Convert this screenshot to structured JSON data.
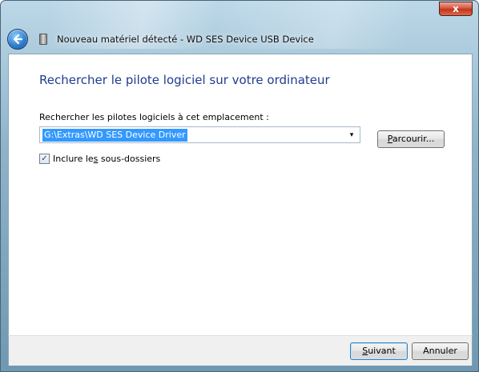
{
  "window": {
    "title": "Nouveau matériel détecté - WD SES Device USB Device",
    "close_symbol": "x"
  },
  "icons": {
    "back": "back-arrow-icon",
    "device": "usb-device-icon",
    "dropdown": "chevron-down-icon",
    "check": "checkmark-icon"
  },
  "colors": {
    "heading": "#1e3d8f",
    "selection": "#3399ff",
    "close_button": "#c0351c"
  },
  "main": {
    "heading": "Rechercher le pilote logiciel sur votre ordinateur",
    "location_label": "Rechercher les pilotes logiciels à cet emplacement :",
    "location_value": "G:\\Extras\\WD SES Device Driver",
    "dropdown_arrow": "▾",
    "browse_label_accel": "P",
    "browse_label_rest": "arcourir...",
    "include_subfolders_pre": "Inclure le",
    "include_subfolders_accel": "s",
    "include_subfolders_post": " sous-dossiers",
    "include_subfolders_checked": true,
    "check_mark": "✓"
  },
  "footer": {
    "next_accel": "S",
    "next_rest": "uivant",
    "cancel_label": "Annuler"
  }
}
